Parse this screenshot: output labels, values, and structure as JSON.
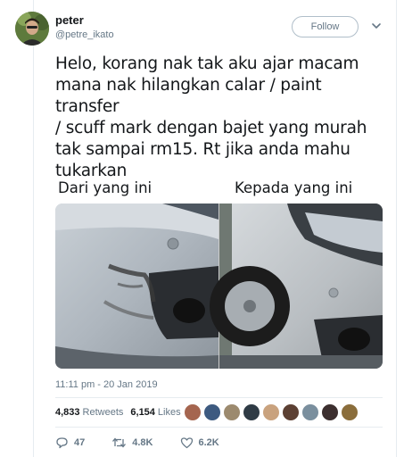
{
  "user": {
    "name": "peter",
    "handle": "@petre_ikato"
  },
  "follow_label": "Follow",
  "tweet": {
    "lines": [
      "Helo, korang nak tak aku ajar macam",
      "mana nak hilangkan calar / paint transfer",
      "/ scuff mark dengan bajet yang murah",
      "tak sampai rm15. Rt jika anda mahu",
      "tukarkan"
    ],
    "caption_left": "Dari yang ini",
    "caption_right": "Kepada yang ini"
  },
  "timestamp": "11:11 pm - 20 Jan 2019",
  "stats": {
    "retweets_count": "4,833",
    "retweets_label": "Retweets",
    "likes_count": "6,154",
    "likes_label": "Likes"
  },
  "likers": [
    {
      "color": "#a5654f"
    },
    {
      "color": "#3d5a80"
    },
    {
      "color": "#9c8a6e"
    },
    {
      "color": "#2f3b45"
    },
    {
      "color": "#c9a27e"
    },
    {
      "color": "#5c4033"
    },
    {
      "color": "#7a8f9e"
    },
    {
      "color": "#3c2f2f"
    },
    {
      "color": "#8a6d3b"
    }
  ],
  "actions": {
    "replies": "47",
    "retweets": "4.8K",
    "likes": "6.2K"
  },
  "icons": {
    "chevron": "chevron-down-icon",
    "reply": "reply-icon",
    "retweet": "retweet-icon",
    "like": "heart-icon"
  }
}
